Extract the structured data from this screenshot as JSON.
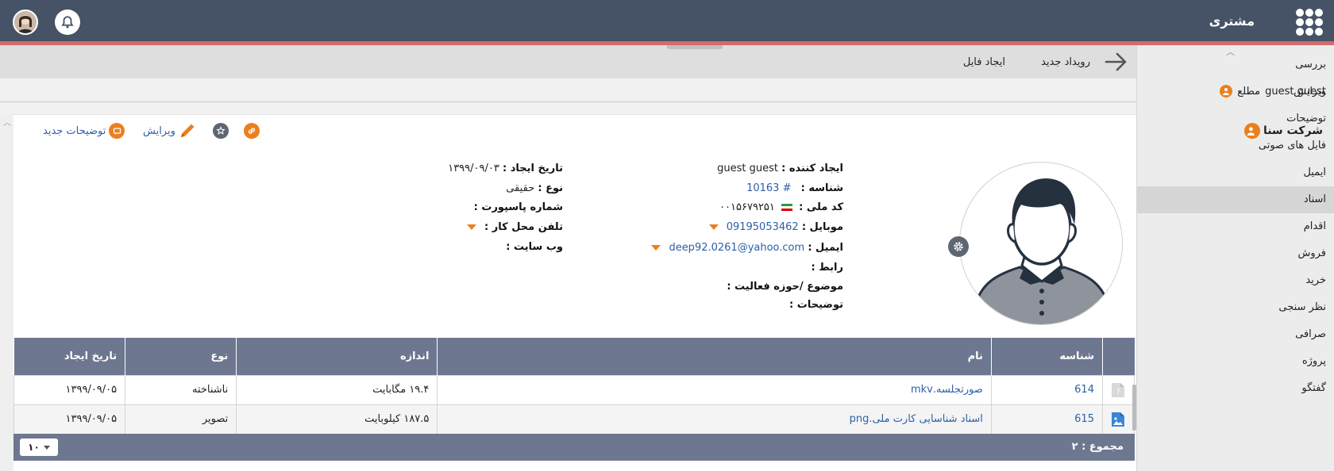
{
  "app": {
    "title": "مشتری"
  },
  "sidebar": {
    "items": [
      {
        "label": "بررسی",
        "active": false
      },
      {
        "label": "ویرایش",
        "active": false
      },
      {
        "label": "توضیحات",
        "active": false
      },
      {
        "label": "فایل های صوتی",
        "active": false
      },
      {
        "label": "ایمیل",
        "active": false
      },
      {
        "label": "اسناد",
        "active": true
      },
      {
        "label": "اقدام",
        "active": false
      },
      {
        "label": "فروش",
        "active": false
      },
      {
        "label": "خرید",
        "active": false
      },
      {
        "label": "نظر سنجی",
        "active": false
      },
      {
        "label": "صرافی",
        "active": false
      },
      {
        "label": "پروژه",
        "active": false
      },
      {
        "label": "گفتگو",
        "active": false
      }
    ]
  },
  "toolbar": {
    "new_event": "رویداد جدید",
    "create_file": "ایجاد فایل"
  },
  "observer": {
    "label": "مطلع",
    "name": "guest guest"
  },
  "record": {
    "company": "شرکت سنا",
    "actions": {
      "edit": "ویرایش",
      "new_note": "توضیحات جدید"
    },
    "left": {
      "created_date_label": "تاریخ ایجاد :",
      "created_date": "۱۳۹۹/۰۹/۰۳",
      "type_label": "نوع :",
      "type": "حقیقی",
      "passport_label": "شماره پاسپورت :",
      "work_phone_label": "تلفن محل کار :",
      "website_label": "وب سایت :"
    },
    "right": {
      "creator_label": "ایجاد کننده :",
      "creator": "guest guest",
      "id_label": "شناسه :",
      "id": "# 10163",
      "national_code_label": "کد ملی :",
      "national_code": "۰۰۱۵۶۷۹۲۵۱",
      "mobile_label": "موبایل :",
      "mobile": "09195053462",
      "email_label": "ایمیل :",
      "email": "deep92.0261@yahoo.com",
      "link_label": "رابط :",
      "subject_label": "موضوع /حوزه فعالیت :",
      "notes_label": "توضیحات :"
    }
  },
  "table": {
    "headers": {
      "id": "شناسه",
      "name": "نام",
      "size": "اندازه",
      "type": "نوع",
      "created": "تاریخ ایجاد"
    },
    "rows": [
      {
        "id": "614",
        "name": "صورتجلسه.mkv",
        "size": "۱۹.۴ مگابایت",
        "type": "ناشناخته",
        "created": "۱۳۹۹/۰۹/۰۵",
        "icon": "unknown-file-icon"
      },
      {
        "id": "615",
        "name": "اسناد شناسایی کارت ملی.png",
        "size": "۱۸۷.۵ کیلوبایت",
        "type": "تصویر",
        "created": "۱۳۹۹/۰۹/۰۵",
        "icon": "image-file-icon"
      }
    ],
    "footer": {
      "total": "مجموع : ۲",
      "page_size": "۱۰"
    }
  },
  "colors": {
    "topbar": "#465266",
    "accent": "#ec7f1d",
    "table_header": "#6d7790",
    "link": "#2e5fa7"
  }
}
